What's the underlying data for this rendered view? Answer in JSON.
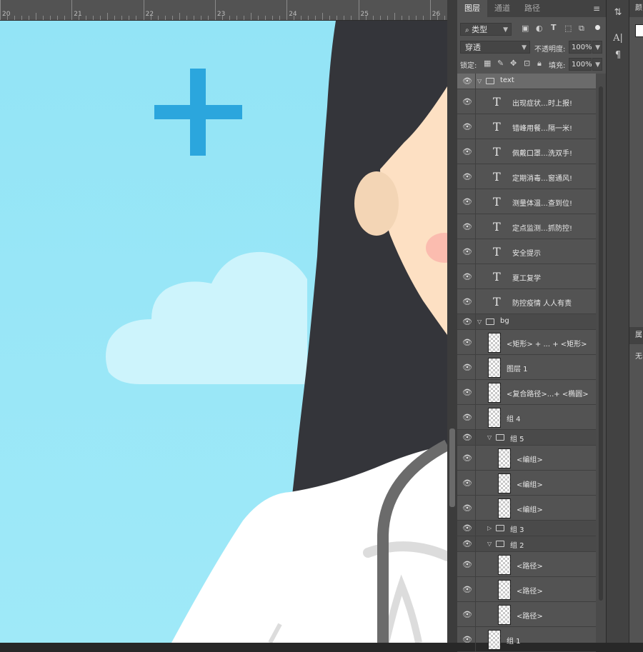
{
  "ruler": {
    "labels": [
      "20",
      "21",
      "22",
      "23",
      "24",
      "25",
      "26"
    ]
  },
  "canvas": {
    "sky_top": "#93e4f6",
    "sky_bottom": "#9fe9f8",
    "cross_color": "#2ba6dd",
    "cloud_color": "#cdf4fc",
    "hair_color": "#34353a",
    "skin_color": "#fde0c3",
    "ear_color": "#f3d5b5",
    "blush_color": "#fbbcaf",
    "coat_color": "#ffffff",
    "stethoscope_color": "#6b6b6b"
  },
  "panel": {
    "tabs": [
      "图层",
      "通道",
      "路径"
    ],
    "active_tab": "图层",
    "filter_kind": "类型",
    "blend_mode": "穿透",
    "opacity_label": "不透明度:",
    "opacity_value": "100%",
    "lock_label": "锁定:",
    "fill_label": "填充:",
    "fill_value": "100%"
  },
  "layers": [
    {
      "name": "text",
      "kind": "group",
      "expanded": true,
      "active": true
    },
    {
      "name": "出现症状…时上报!",
      "kind": "text"
    },
    {
      "name": "错峰用餐…隔一米!",
      "kind": "text"
    },
    {
      "name": "佩戴口罩…洗双手!",
      "kind": "text"
    },
    {
      "name": "定期消毒…窗通风!",
      "kind": "text"
    },
    {
      "name": "测量体温…查到位!",
      "kind": "text"
    },
    {
      "name": "定点监测…抓防控!",
      "kind": "text"
    },
    {
      "name": "安全提示",
      "kind": "text"
    },
    {
      "name": "夏工复学",
      "kind": "text"
    },
    {
      "name": "防控疫情 人人有责",
      "kind": "text"
    },
    {
      "name": "bg",
      "kind": "group",
      "expanded": true
    },
    {
      "name": "<矩形> + ... + <矩形>",
      "kind": "image"
    },
    {
      "name": "图层 1",
      "kind": "image"
    },
    {
      "name": "<复合路径>...+ <椭圆>",
      "kind": "image"
    },
    {
      "name": "组 4",
      "kind": "image"
    },
    {
      "name": "组 5",
      "kind": "group",
      "expanded": true
    },
    {
      "name": "<编组>",
      "kind": "image",
      "indent": true
    },
    {
      "name": "<编组>",
      "kind": "image",
      "indent": true
    },
    {
      "name": "<编组>",
      "kind": "image",
      "indent": true
    },
    {
      "name": "组 3",
      "kind": "group",
      "expanded": false
    },
    {
      "name": "组 2",
      "kind": "group",
      "expanded": true
    },
    {
      "name": "<路径>",
      "kind": "image",
      "indent": true
    },
    {
      "name": "<路径>",
      "kind": "image",
      "indent": true
    },
    {
      "name": "<路径>",
      "kind": "image",
      "indent": true
    },
    {
      "name": "组 1",
      "kind": "image"
    }
  ],
  "right_panel": {
    "tab_label": "颜",
    "tab2_label": "属",
    "tab2_value": "无"
  }
}
